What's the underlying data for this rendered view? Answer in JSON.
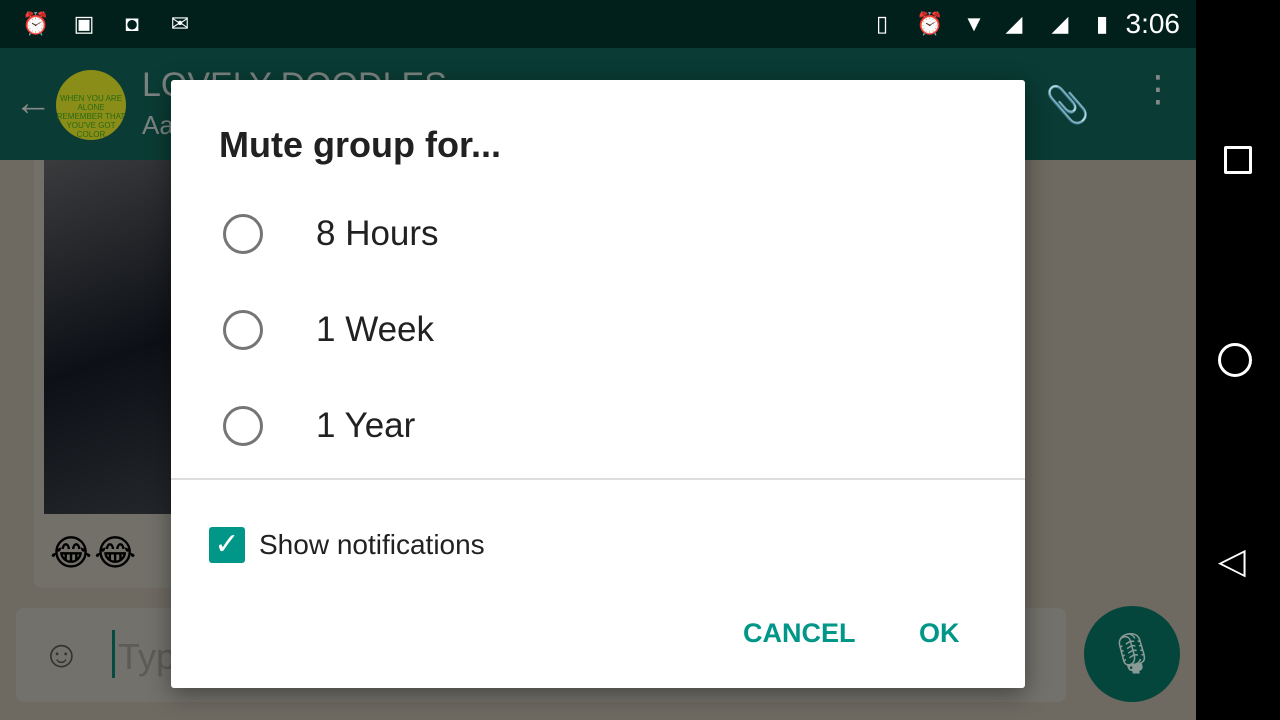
{
  "status_bar": {
    "time": "3:06",
    "icons": [
      "alarm-icon",
      "image-icon",
      "android-icon",
      "gmail-icon",
      "vibrate-icon",
      "alarm-icon",
      "wifi-icon",
      "signal-roaming-icon",
      "signal-icon",
      "battery-icon"
    ],
    "roaming": "R"
  },
  "header": {
    "group_name": "LOVELY DOODLES",
    "subtitle": "Aa",
    "avatar_text": "WHEN YOU ARE ALONE REMEMBER THAT YOU'VE GOT COLOR"
  },
  "chat": {
    "emoji": "😂😂",
    "input_placeholder": "Type"
  },
  "dialog": {
    "title": "Mute group for...",
    "options": [
      {
        "label": "8 Hours",
        "selected": false
      },
      {
        "label": "1 Week",
        "selected": false
      },
      {
        "label": "1 Year",
        "selected": false
      }
    ],
    "show_notifications": {
      "label": "Show notifications",
      "checked": true
    },
    "cancel_label": "CANCEL",
    "ok_label": "OK"
  },
  "colors": {
    "accent": "#009688",
    "header": "#075e54"
  }
}
